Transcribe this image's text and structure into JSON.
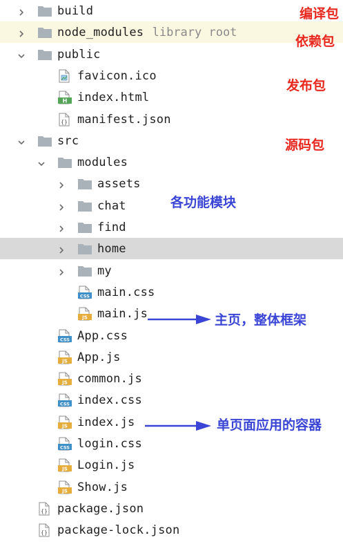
{
  "tree": [
    {
      "label": "build",
      "type": "folder",
      "depth": 0,
      "expander": "collapsed"
    },
    {
      "label": "node_modules",
      "hint": "library root",
      "type": "folder",
      "depth": 0,
      "expander": "collapsed",
      "library": true
    },
    {
      "label": "public",
      "type": "folder",
      "depth": 0,
      "expander": "expanded"
    },
    {
      "label": "favicon.ico",
      "type": "image",
      "depth": 1,
      "expander": "none"
    },
    {
      "label": "index.html",
      "type": "html",
      "depth": 1,
      "expander": "none"
    },
    {
      "label": "manifest.json",
      "type": "json",
      "depth": 1,
      "expander": "none"
    },
    {
      "label": "src",
      "type": "folder",
      "depth": 0,
      "expander": "expanded"
    },
    {
      "label": "modules",
      "type": "folder",
      "depth": 1,
      "expander": "expanded"
    },
    {
      "label": "assets",
      "type": "folder",
      "depth": 2,
      "expander": "collapsed"
    },
    {
      "label": "chat",
      "type": "folder",
      "depth": 2,
      "expander": "collapsed"
    },
    {
      "label": "find",
      "type": "folder",
      "depth": 2,
      "expander": "collapsed"
    },
    {
      "label": "home",
      "type": "folder",
      "depth": 2,
      "expander": "collapsed",
      "selected": true
    },
    {
      "label": "my",
      "type": "folder",
      "depth": 2,
      "expander": "collapsed"
    },
    {
      "label": "main.css",
      "type": "css",
      "depth": 2,
      "expander": "none"
    },
    {
      "label": "main.js",
      "type": "js",
      "depth": 2,
      "expander": "none"
    },
    {
      "label": "App.css",
      "type": "css",
      "depth": 1,
      "expander": "none"
    },
    {
      "label": "App.js",
      "type": "js",
      "depth": 1,
      "expander": "none"
    },
    {
      "label": "common.js",
      "type": "js",
      "depth": 1,
      "expander": "none"
    },
    {
      "label": "index.css",
      "type": "css",
      "depth": 1,
      "expander": "none"
    },
    {
      "label": "index.js",
      "type": "js",
      "depth": 1,
      "expander": "none"
    },
    {
      "label": "login.css",
      "type": "css",
      "depth": 1,
      "expander": "none"
    },
    {
      "label": "Login.js",
      "type": "js",
      "depth": 1,
      "expander": "none"
    },
    {
      "label": "Show.js",
      "type": "js",
      "depth": 1,
      "expander": "none"
    },
    {
      "label": "package.json",
      "type": "json",
      "depth": 0,
      "expander": "none"
    },
    {
      "label": "package-lock.json",
      "type": "json",
      "depth": 0,
      "expander": "none"
    }
  ],
  "annotations": {
    "build": "编译包",
    "node_modules": "依赖包",
    "publish": "发布包",
    "source": "源码包",
    "feature_modules": "各功能模块",
    "main_page": "主页，整体框架",
    "spa_container": "单页面应用的容器"
  },
  "icon_labels": {
    "html": "H",
    "css": "CSS",
    "js": "JS",
    "json": "{}"
  },
  "colors": {
    "folder": "#a9b1b9",
    "selected_row": "#d9d9d9",
    "library_row": "#fbf8e2",
    "annotation_red": "#e8281e",
    "annotation_blue": "#3a45d6",
    "css_badge": "#3f8fc8",
    "js_badge": "#e5ad3b",
    "html_badge": "#54a557"
  }
}
